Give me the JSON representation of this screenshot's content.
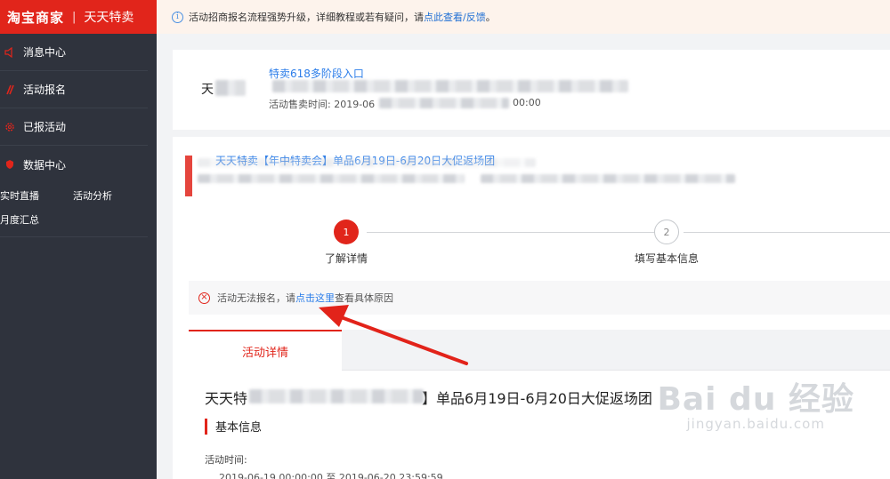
{
  "brand": {
    "main": "淘宝商家",
    "separator": "|",
    "sub": "天天特卖"
  },
  "sidebar": {
    "items": [
      {
        "label": "消息中心",
        "icon": "speaker-icon"
      },
      {
        "label": "活动报名",
        "icon": "slash-icon"
      },
      {
        "label": "已报活动",
        "icon": "gear-icon"
      },
      {
        "label": "数据中心",
        "icon": "shield-icon"
      }
    ],
    "sub": [
      "实时直播",
      "活动分析",
      "月度汇总"
    ]
  },
  "notice": {
    "text": "活动招商报名流程强势升级，详细教程或若有疑问，请",
    "link": "点此查看/反馈",
    "end": "。"
  },
  "card1": {
    "name": "天",
    "title": "特卖618多阶段入口",
    "time_label": "活动售卖时间: 2019-06",
    "time_tail": "00:00"
  },
  "card2": {
    "title": "天天特卖【年中特卖会】单品6月19日-6月20日大促返场团"
  },
  "steps": [
    {
      "num": "1",
      "label": "了解详情"
    },
    {
      "num": "2",
      "label": "填写基本信息"
    }
  ],
  "alert": {
    "text": "活动无法报名，请",
    "link": "点击这里",
    "tail": "查看具体原因"
  },
  "tabs": {
    "active": "活动详情"
  },
  "detail": {
    "title_start": "天天特",
    "title_end": "】单品6月19日-6月20日大促返场团",
    "section": "基本信息",
    "field_label": "活动时间:",
    "field_value": "2019-06-19 00:00:00 至 2019-06-20 23:59:59"
  },
  "watermark": {
    "logo": "Bai du 经验",
    "url": "jingyan.baidu.com"
  },
  "colors": {
    "accent": "#e1251b",
    "link": "#2b7de9",
    "sidebar": "#2f333d"
  }
}
